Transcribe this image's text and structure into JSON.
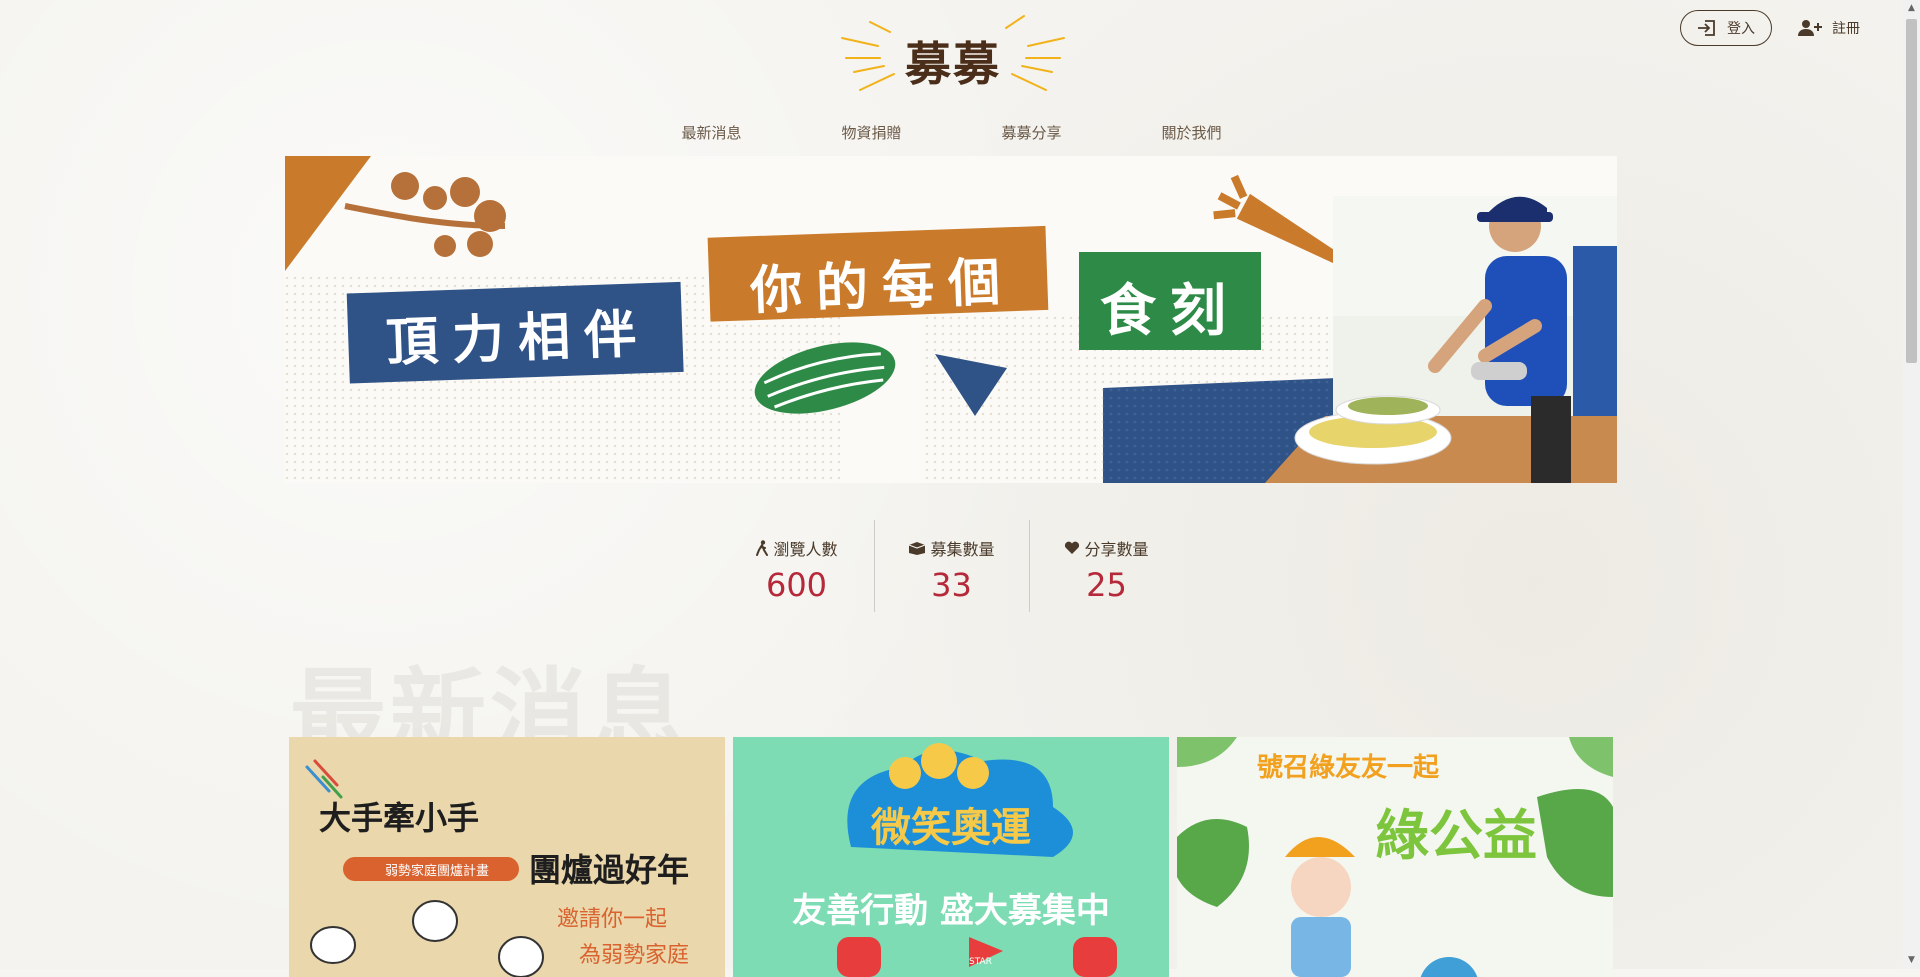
{
  "logo": {
    "text": "募募"
  },
  "auth": {
    "login_label": "登入",
    "register_label": "註冊"
  },
  "nav": {
    "items": [
      "最新消息",
      "物資捐贈",
      "募募分享",
      "關於我們"
    ]
  },
  "banner": {
    "phrases": [
      "頂力相伴",
      "你的每個",
      "食刻"
    ],
    "colors": {
      "blue": "#2f5287",
      "orange": "#c97a2a",
      "green": "#2e8b47"
    }
  },
  "stats": [
    {
      "icon": "person-icon",
      "label": "瀏覽人數",
      "value": "600"
    },
    {
      "icon": "box-icon",
      "label": "募集數量",
      "value": "33"
    },
    {
      "icon": "heart-icon",
      "label": "分享數量",
      "value": "25"
    }
  ],
  "news": {
    "title": "最新消息",
    "cards": [
      {
        "lines": [
          "大手牽小手",
          "團爐過好年",
          "弱勢家庭團爐計畫",
          "邀請你一起",
          "為弱勢家庭"
        ],
        "bg": "#ead7ac"
      },
      {
        "lines": [
          "微笑奧運",
          "友善行動 盛大募集中",
          "STAR"
        ],
        "bg": "#7ddcb4"
      },
      {
        "lines": [
          "號召綠友友一起",
          "綠公益"
        ],
        "bg": "#f4f6f0"
      }
    ]
  },
  "accent_color": "#b5293a"
}
